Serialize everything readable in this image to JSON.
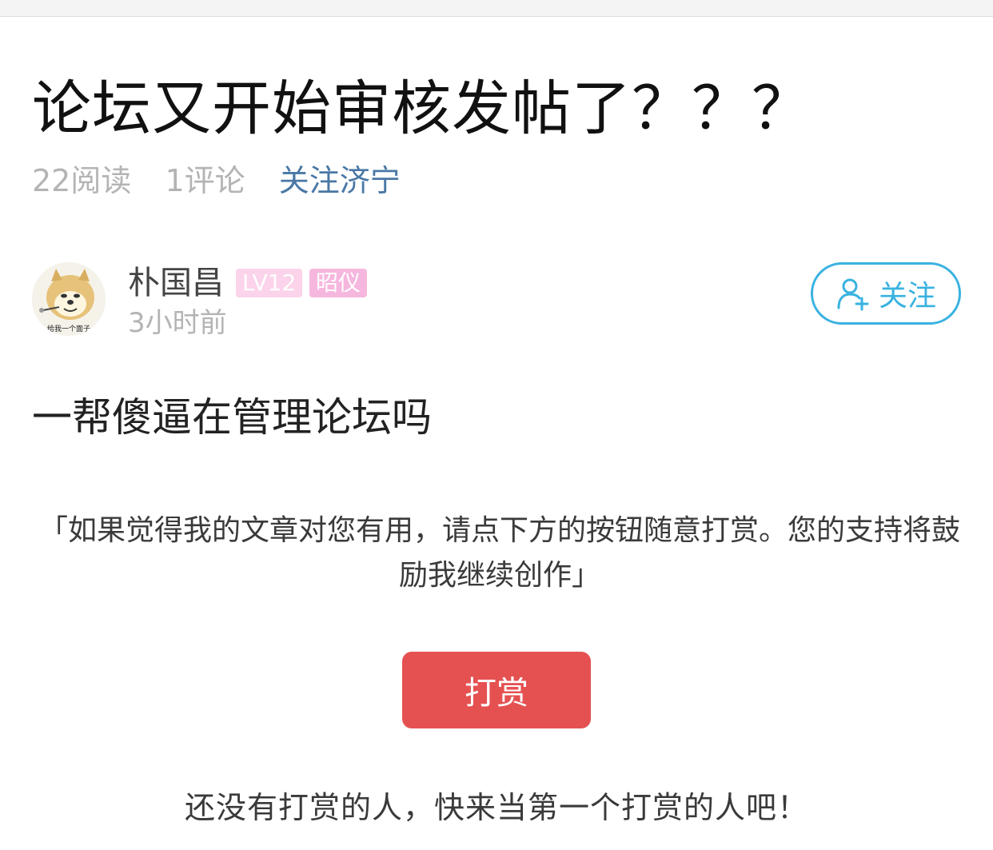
{
  "post": {
    "title": "论坛又开始审核发帖了？？？",
    "reads": "22阅读",
    "comments": "1评论",
    "follow_link": "关注济宁",
    "body": "一帮傻逼在管理论坛吗"
  },
  "author": {
    "name": "朴国昌",
    "level_badge": "LV12",
    "title_badge": "昭仪",
    "time": "3小时前",
    "avatar_caption": "给我一个面子"
  },
  "follow_button": {
    "label": "关注",
    "icon": "add-user-icon"
  },
  "reward": {
    "note": "「如果觉得我的文章对您有用，请点下方的按钮随意打赏。您的支持将鼓励我继续创作」",
    "button_label": "打赏",
    "empty_text": "还没有打赏的人，快来当第一个打赏的人吧！"
  },
  "colors": {
    "follow_link": "#4a78a6",
    "follow_button": "#39b2e0",
    "reward_button": "#e55151",
    "level_badge_bg": "#fbd3ea",
    "title_badge_bg": "#f6b7de"
  }
}
